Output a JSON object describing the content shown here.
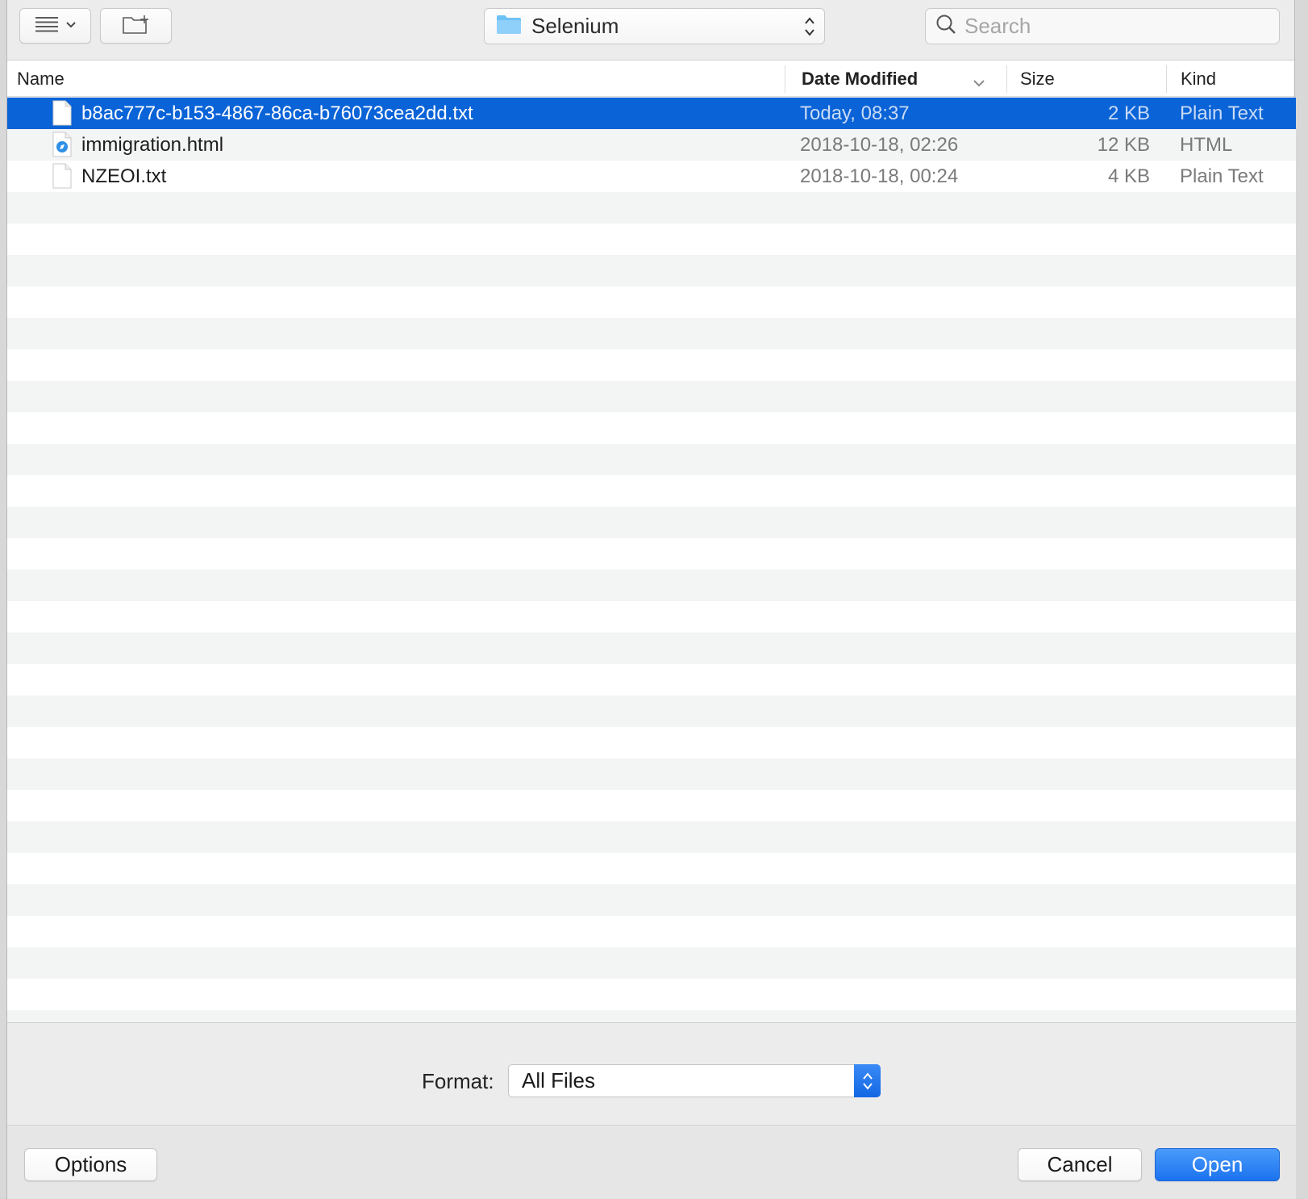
{
  "toolbar": {
    "view_icon": "list-view-icon",
    "new_folder_icon": "new-folder-icon",
    "location": {
      "label": "Selenium",
      "icon": "folder-icon"
    },
    "search": {
      "placeholder": "Search",
      "value": ""
    }
  },
  "columns": {
    "name": "Name",
    "date_modified": "Date Modified",
    "size": "Size",
    "kind": "Kind"
  },
  "files": [
    {
      "name": "b8ac777c-b153-4867-86ca-b76073cea2dd.txt",
      "date": "Today, 08:37",
      "size": "2 KB",
      "kind": "Plain Text",
      "icon": "text-file-icon",
      "selected": true
    },
    {
      "name": "immigration.html",
      "date": "2018-10-18, 02:26",
      "size": "12 KB",
      "kind": "HTML",
      "icon": "html-file-icon",
      "selected": false
    },
    {
      "name": "NZEOI.txt",
      "date": "2018-10-18, 00:24",
      "size": "4 KB",
      "kind": "Plain Text",
      "icon": "text-file-icon",
      "selected": false
    }
  ],
  "format": {
    "label": "Format:",
    "value": "All Files"
  },
  "buttons": {
    "options": "Options",
    "cancel": "Cancel",
    "open": "Open"
  },
  "colors": {
    "selection": "#0a63d7",
    "accent": "#1b72ee"
  }
}
